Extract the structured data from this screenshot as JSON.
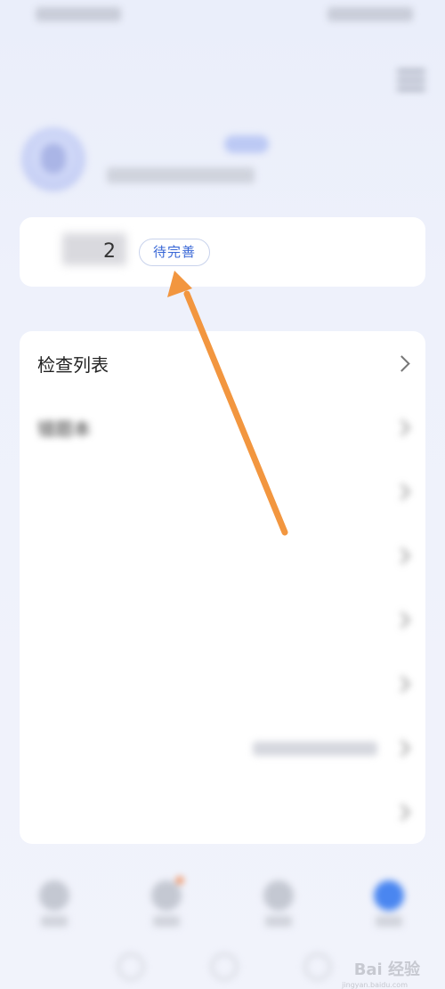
{
  "status_bar": {
    "left_text": "",
    "right_text": ""
  },
  "header": {
    "menu_icon": "hamburger-menu-icon"
  },
  "user": {
    "name": "",
    "tag": "",
    "subtitle": ""
  },
  "profile_card": {
    "name_suffix": "2",
    "badge_label": "待完善"
  },
  "list": [
    {
      "label": "检查列表",
      "value": "",
      "icon": "chevron-right-icon"
    },
    {
      "label": "错题本",
      "value": "",
      "icon": "chevron-right-icon"
    },
    {
      "label": "",
      "value": "",
      "icon": "chevron-right-icon"
    },
    {
      "label": "",
      "value": "",
      "icon": "chevron-right-icon"
    },
    {
      "label": "",
      "value": "",
      "icon": "chevron-right-icon"
    },
    {
      "label": "",
      "value": "",
      "icon": "chevron-right-icon"
    },
    {
      "label": "",
      "value": "",
      "icon": "chevron-right-icon"
    },
    {
      "label": "",
      "value": "",
      "icon": "chevron-right-icon"
    }
  ],
  "bottom_nav": [
    {
      "label": "",
      "icon": "home-icon",
      "active": false
    },
    {
      "label": "",
      "icon": "calendar-icon",
      "active": false,
      "has_dot": true
    },
    {
      "label": "",
      "icon": "chat-icon",
      "active": false
    },
    {
      "label": "",
      "icon": "profile-icon",
      "active": true
    }
  ],
  "watermark": {
    "text": "Bai 经验",
    "sub": "jingyan.baidu.com"
  },
  "annotation": {
    "arrow_color": "#f2963f"
  }
}
